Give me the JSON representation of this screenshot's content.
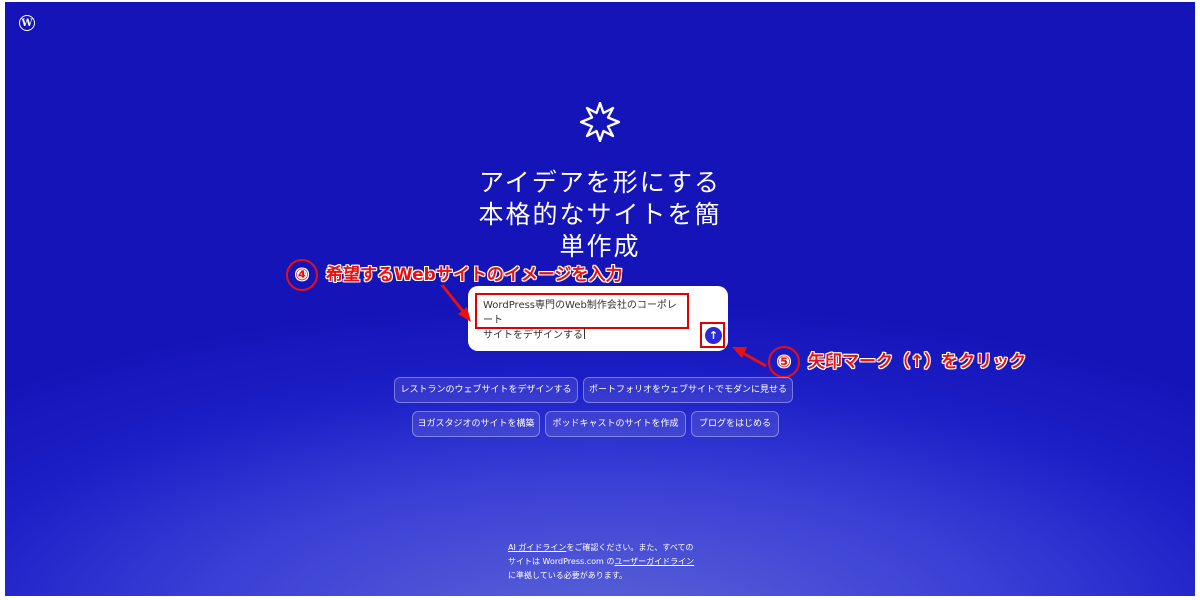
{
  "logo": {
    "icon": "wordpress-logo-icon",
    "glyph": "W"
  },
  "hero": {
    "icon": "sparkle-icon",
    "headline_lines": [
      "アイデアを形にする",
      "本格的なサイトを簡",
      "単作成"
    ]
  },
  "prompt": {
    "value_line1": "WordPress専門のWeb制作会社のコーポレート",
    "value_line2": "サイトをデザインする",
    "submit_icon": "arrow-up-icon",
    "submit_glyph": "↑"
  },
  "suggestions": [
    {
      "label": "レストランのウェブサイトをデザインする"
    },
    {
      "label": "ポートフォリオをウェブサイトでモダンに見せる"
    },
    {
      "label": "ヨガスタジオのサイトを構築"
    },
    {
      "label": "ポッドキャストのサイトを作成"
    },
    {
      "label": "ブログをはじめる"
    }
  ],
  "annotations": {
    "step4": {
      "number": "④",
      "text": "希望するWebサイトのイメージを入力"
    },
    "step5": {
      "number": "⑤",
      "text": "矢印マーク（↑）をクリック"
    },
    "color": "#e81010"
  },
  "footer": {
    "link1": "AI ガイドライン",
    "text1": "をご確認ください。また、すべてのサイトは WordPress.com の",
    "link2": "ユーザーガイドライン",
    "text2": "に準拠している必要があります。"
  },
  "colors": {
    "background": "#1c1fc6",
    "submit": "#2a2ad8",
    "highlight": "#e00000"
  }
}
